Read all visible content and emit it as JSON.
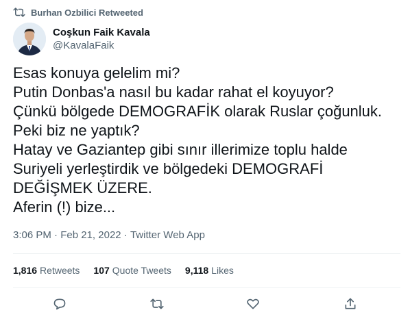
{
  "retweet_header": {
    "text": "Burhan Ozbilici Retweeted",
    "icon": "retweet-icon"
  },
  "author": {
    "display_name": "Coşkun Faik Kavala",
    "handle": "@KavalaFaik"
  },
  "tweet_lines": [
    "Esas konuya gelelim mi?",
    "Putin Donbas'a nasıl bu kadar rahat el koyuyor?",
    "Çünkü bölgede DEMOGRAFİK olarak Ruslar çoğunluk.",
    "Peki biz ne yaptık?",
    "Hatay ve Gaziantep gibi sınır illerimize toplu halde",
    "Suriyeli yerleştirdik ve bölgedeki DEMOGRAFİ",
    "DEĞİŞMEK ÜZERE.",
    "Aferin (!) bize..."
  ],
  "meta": {
    "time": "3:06 PM",
    "sep1": " · ",
    "date": "Feb 21, 2022",
    "sep2": " · ",
    "source": "Twitter Web App"
  },
  "stats": {
    "retweets_count": "1,816",
    "retweets_label": "Retweets",
    "quotes_count": "107",
    "quotes_label": "Quote Tweets",
    "likes_count": "9,118",
    "likes_label": "Likes"
  },
  "actions": [
    "reply-icon",
    "retweet-icon",
    "like-icon",
    "share-icon"
  ],
  "colors": {
    "text": "#0f1419",
    "secondary": "#536471",
    "divider": "#eff3f4"
  }
}
